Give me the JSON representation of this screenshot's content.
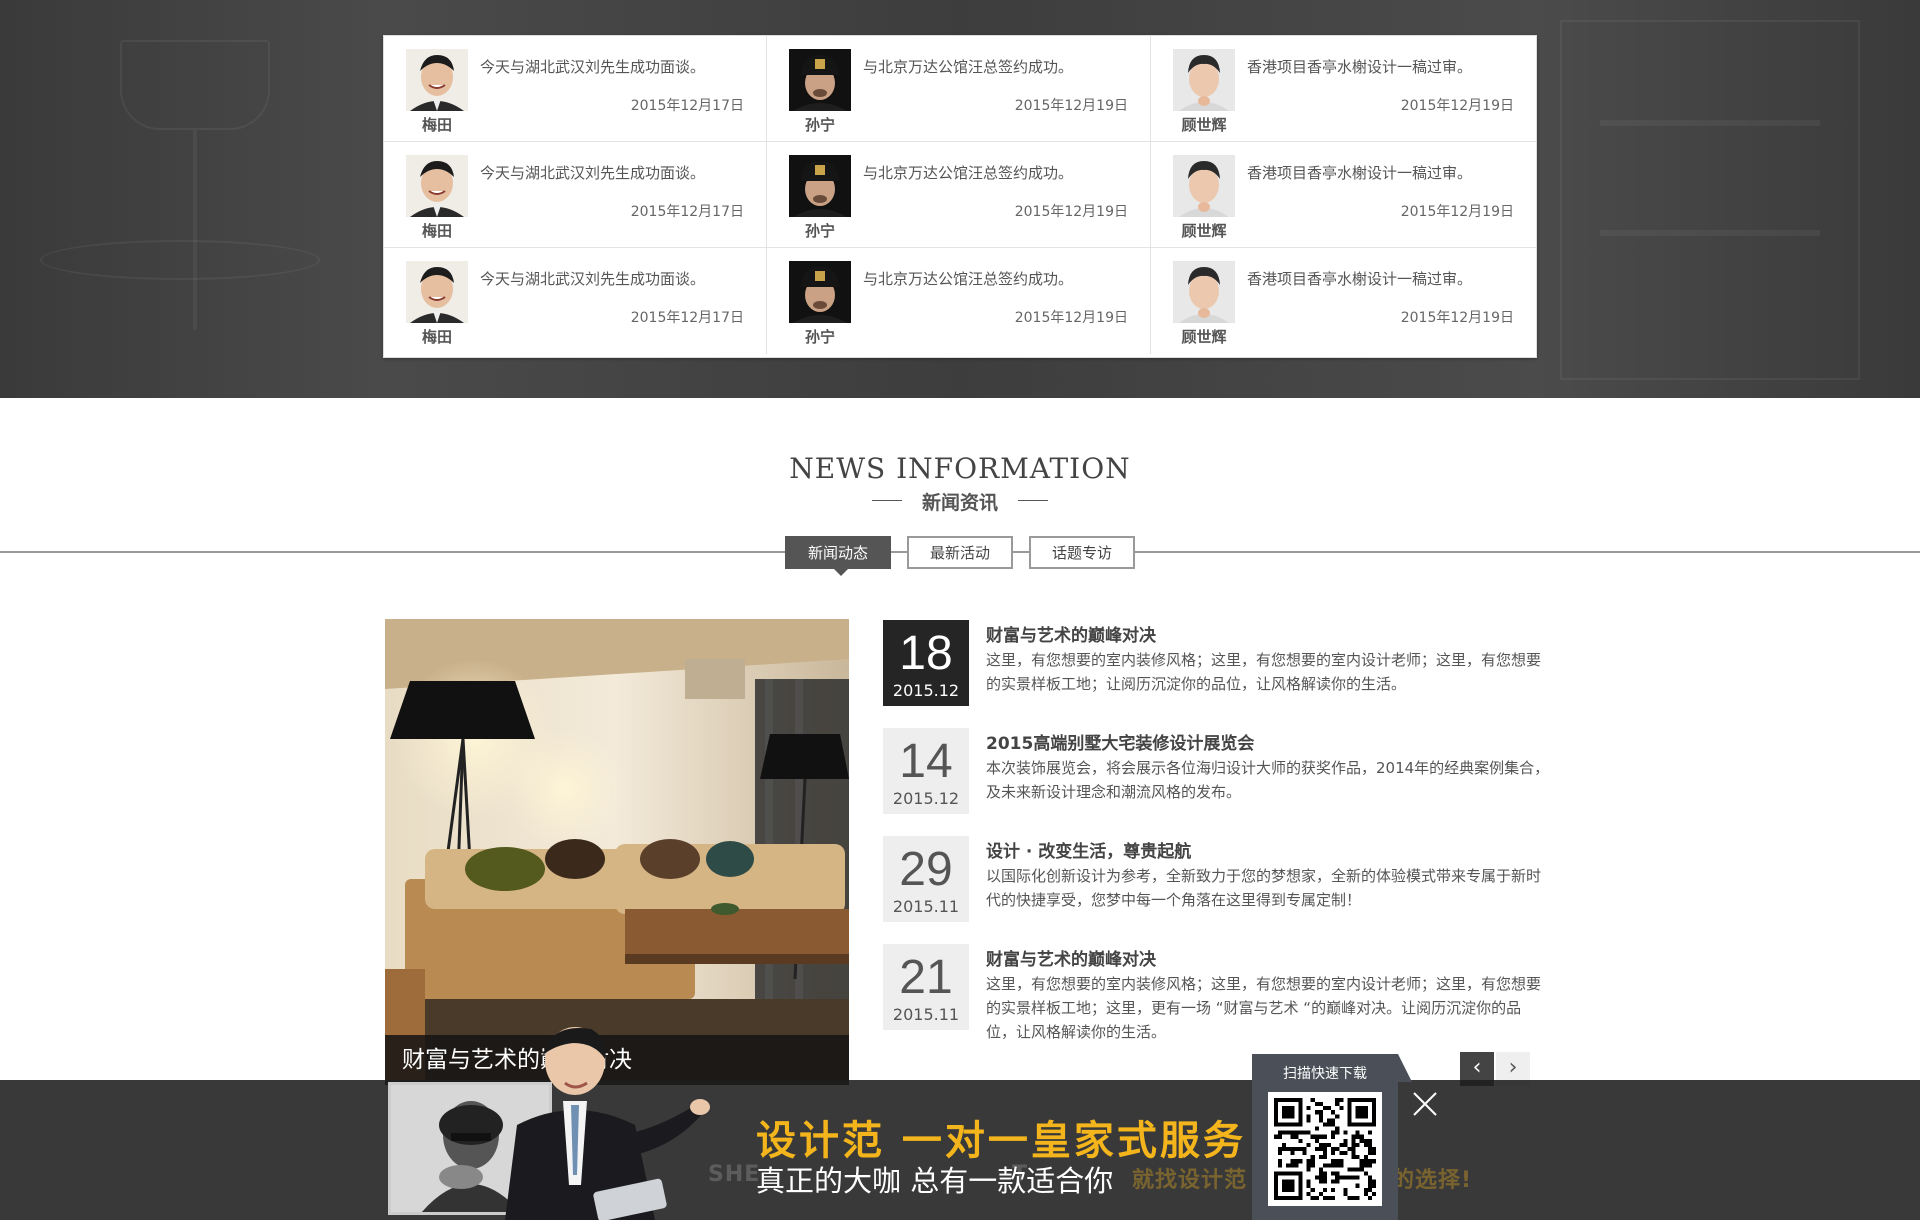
{
  "top_section": {
    "partial_title": "",
    "testimonials": [
      {
        "name": "梅田",
        "message": "今天与湖北武汉刘先生成功面谈。",
        "date": "2015年12月17日",
        "avatar": "face-smiling"
      },
      {
        "name": "孙宁",
        "message": "与北京万达公馆汪总签约成功。",
        "date": "2015年12月19日",
        "avatar": "face-cap"
      },
      {
        "name": "顾世辉",
        "message": "香港项目香亭水榭设计一稿过审。",
        "date": "2015年12月19日",
        "avatar": "face-young"
      },
      {
        "name": "梅田",
        "message": "今天与湖北武汉刘先生成功面谈。",
        "date": "2015年12月17日",
        "avatar": "face-smiling"
      },
      {
        "name": "孙宁",
        "message": "与北京万达公馆汪总签约成功。",
        "date": "2015年12月19日",
        "avatar": "face-cap"
      },
      {
        "name": "顾世辉",
        "message": "香港项目香亭水榭设计一稿过审。",
        "date": "2015年12月19日",
        "avatar": "face-young"
      },
      {
        "name": "梅田",
        "message": "今天与湖北武汉刘先生成功面谈。",
        "date": "2015年12月17日",
        "avatar": "face-smiling"
      },
      {
        "name": "孙宁",
        "message": "与北京万达公馆汪总签约成功。",
        "date": "2015年12月19日",
        "avatar": "face-cap"
      },
      {
        "name": "顾世辉",
        "message": "香港项目香亭水榭设计一稿过审。",
        "date": "2015年12月19日",
        "avatar": "face-young"
      }
    ]
  },
  "news": {
    "title_en": "NEWS INFORMATION",
    "title_zh": "新闻资讯",
    "tabs": [
      {
        "label": "新闻动态",
        "active": true
      },
      {
        "label": "最新活动",
        "active": false
      },
      {
        "label": "话题专访",
        "active": false
      }
    ],
    "feature": {
      "caption": "财富与艺术的巅峰对决"
    },
    "items": [
      {
        "day": "18",
        "ym": "2015.12",
        "title": "财富与艺术的巅峰对决",
        "body": "这里，有您想要的室内装修风格；这里，有您想要的室内设计老师；这里，有您想要的实景样板工地；让阅历沉淀你的品位，让风格解读你的生活。",
        "highlight": true
      },
      {
        "day": "14",
        "ym": "2015.12",
        "title": "2015高端别墅大宅装修设计展览会",
        "body": "本次装饰展览会，将会展示各位海归设计大师的获奖作品，2014年的经典案例集合，及未来新设计理念和潮流风格的发布。",
        "highlight": false
      },
      {
        "day": "29",
        "ym": "2015.11",
        "title": "设计 · 改变生活，尊贵起航",
        "body": " 以国际化创新设计为参考，全新致力于您的梦想家，全新的体验模式带来专属于新时代的快捷享受，您梦中每一个角落在这里得到专属定制！",
        "highlight": false
      },
      {
        "day": "21",
        "ym": "2015.11",
        "title": "财富与艺术的巅峰对决",
        "body": "这里，有您想要的室内装修风格；这里，有您想要的室内设计老师；这里，有您想要的实景样板工地；这里，更有一场 “财富与艺术 “的巅峰对决。让阅历沉淀你的品位，让风格解读你的生活。",
        "highlight": false
      }
    ],
    "pager": {
      "prev": "‹",
      "next": "›"
    }
  },
  "ad": {
    "slogan": "设计范  一对一皇家式服务",
    "sub": "真正的大咖 总有一款适合你",
    "shadow_left": "SHE",
    "shadow_mid": "T",
    "shadow_right": "就找设计范",
    "shadow_right2": "的选择!",
    "qr_label": "扫描快速下载",
    "close": "×"
  },
  "colors": {
    "accent_gold": "#f3b51b",
    "dark_band": "#404040",
    "tab_active": "#555555",
    "qr_panel": "#4a4f58"
  }
}
